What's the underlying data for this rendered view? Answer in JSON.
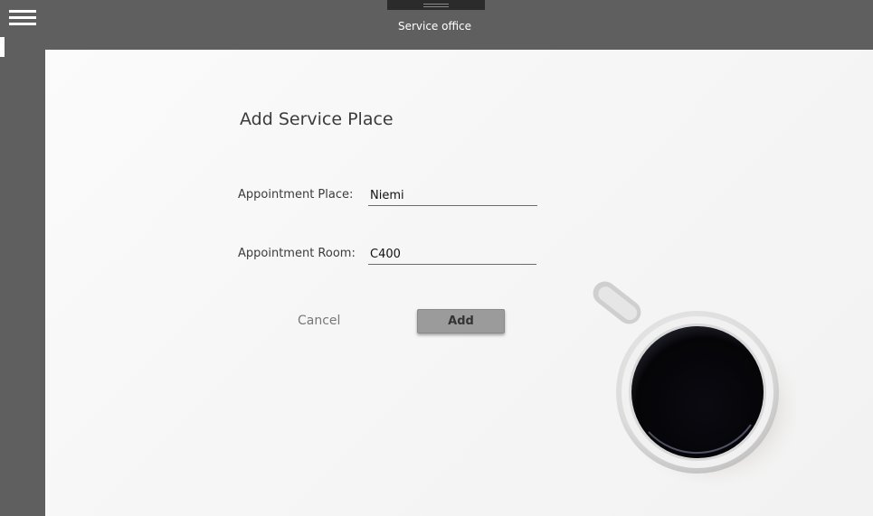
{
  "window": {
    "title": "Service office"
  },
  "form": {
    "title": "Add Service Place",
    "fields": {
      "place": {
        "label": "Appointment Place:",
        "value": "Niemi"
      },
      "room": {
        "label": "Appointment Room:",
        "value": "C400"
      }
    },
    "cancel_label": "Cancel",
    "add_label": "Add"
  },
  "icons": {
    "menu": "hamburger-menu-icon",
    "decoration": "coffee-cup-image"
  },
  "colors": {
    "chrome": "#5f5f5f",
    "content_bg": "#f7f7f7",
    "add_button": "#9b9b9b",
    "text": "#3b3b3b"
  }
}
